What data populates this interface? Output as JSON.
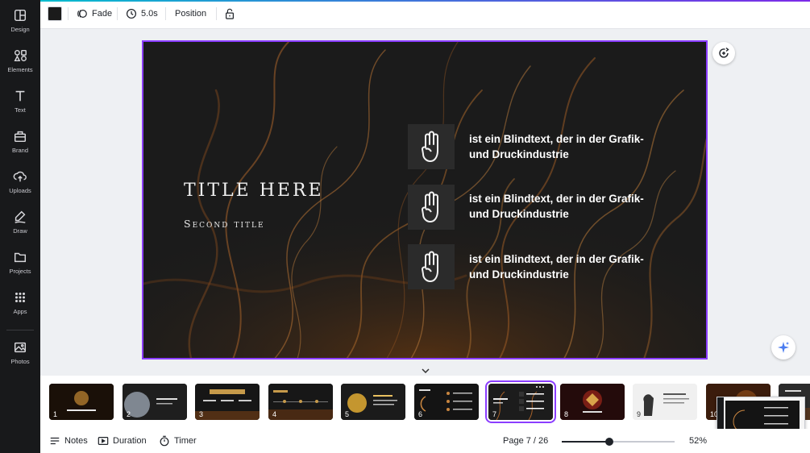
{
  "sidebar": {
    "items": [
      {
        "label": "Design",
        "icon": "layout-icon"
      },
      {
        "label": "Elements",
        "icon": "shapes-icon"
      },
      {
        "label": "Text",
        "icon": "text-icon"
      },
      {
        "label": "Brand",
        "icon": "brand-icon"
      },
      {
        "label": "Uploads",
        "icon": "upload-cloud-icon"
      },
      {
        "label": "Draw",
        "icon": "draw-icon"
      },
      {
        "label": "Projects",
        "icon": "folder-icon"
      },
      {
        "label": "Apps",
        "icon": "apps-grid-icon"
      },
      {
        "label": "Photos",
        "icon": "photo-icon"
      }
    ]
  },
  "toolbar": {
    "color": "#1b1b1b",
    "animation_label": "Fade",
    "duration_label": "5.0s",
    "position_label": "Position"
  },
  "slide": {
    "title": "TITLE HERE",
    "subtitle": "Second title",
    "items": [
      {
        "text": "ist ein Blindtext, der in der Grafik- und Druckindustrie"
      },
      {
        "text": "ist ein Blindtext, der in der Grafik- und Druckindustrie"
      },
      {
        "text": "ist ein Blindtext, der in der Grafik- und Druckindustrie"
      }
    ]
  },
  "thumbnails": [
    {
      "num": "1",
      "theme": "dark"
    },
    {
      "num": "2",
      "theme": "dark"
    },
    {
      "num": "3",
      "theme": "dark"
    },
    {
      "num": "4",
      "theme": "dark"
    },
    {
      "num": "5",
      "theme": "dark"
    },
    {
      "num": "6",
      "theme": "dark"
    },
    {
      "num": "7",
      "theme": "dark",
      "selected": true
    },
    {
      "num": "8",
      "theme": "dark"
    },
    {
      "num": "9",
      "theme": "light"
    },
    {
      "num": "10",
      "theme": "dark"
    }
  ],
  "bottom": {
    "notes_label": "Notes",
    "duration_label": "Duration",
    "timer_label": "Timer",
    "page_indicator": "Page 7 / 26",
    "zoom_percent": "52%",
    "zoom_level": 0.52
  },
  "colors": {
    "accent": "#8b3dff",
    "sidebar_bg": "#18191b",
    "slide_bg": "#1c1c1c"
  }
}
